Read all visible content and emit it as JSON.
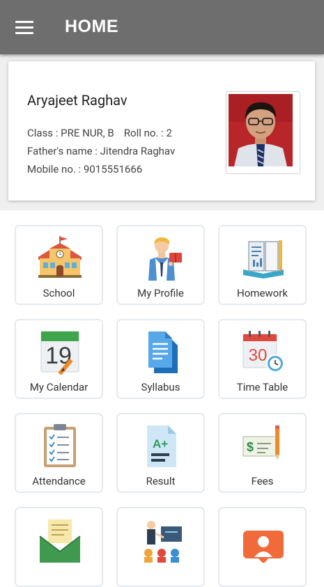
{
  "appbar": {
    "title": "HOME"
  },
  "student": {
    "name": "Aryajeet Raghav",
    "class_text": "Class : PRE NUR, B",
    "roll_text": "Roll no. : 2",
    "father_text": "Father's name : Jitendra Raghav",
    "mobile_text": "Mobile no. : 9015551666"
  },
  "tiles": [
    {
      "label": "School",
      "icon": "school-building-icon"
    },
    {
      "label": "My Profile",
      "icon": "student-profile-icon"
    },
    {
      "label": "Homework",
      "icon": "homework-books-icon"
    },
    {
      "label": "My Calendar",
      "icon": "calendar-19-icon",
      "icon_text": "19"
    },
    {
      "label": "Syllabus",
      "icon": "syllabus-documents-icon"
    },
    {
      "label": "Time Table",
      "icon": "timetable-calendar-clock-icon",
      "icon_text": "30"
    },
    {
      "label": "Attendance",
      "icon": "attendance-clipboard-icon"
    },
    {
      "label": "Result",
      "icon": "result-grade-icon",
      "icon_text": "A+"
    },
    {
      "label": "Fees",
      "icon": "fees-cheque-icon",
      "icon_text": "$"
    },
    {
      "label": "",
      "icon": "mail-envelope-icon"
    },
    {
      "label": "",
      "icon": "teacher-class-icon"
    },
    {
      "label": "",
      "icon": "contact-profile-icon"
    }
  ]
}
